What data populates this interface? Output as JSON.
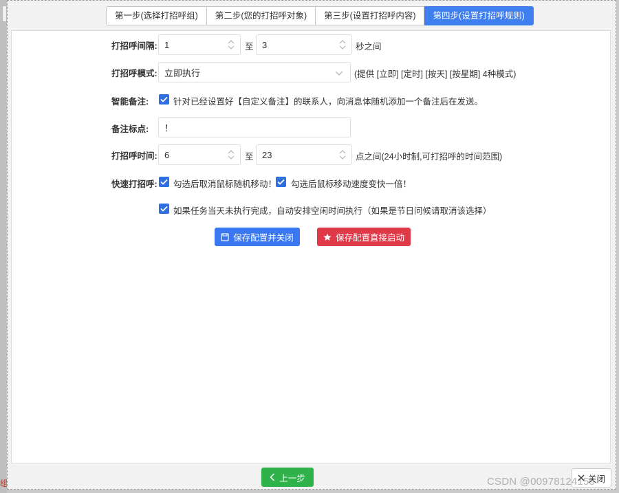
{
  "colors": {
    "accent": "#3f7ff0",
    "primary_button": "#3a78f2",
    "danger_button": "#e03a48",
    "success_button": "#2fb24a",
    "checkbox": "#2f6fe0"
  },
  "left_strip": {
    "text": "组"
  },
  "steps": [
    {
      "label": "第一步(选择打招呼组)",
      "active": false
    },
    {
      "label": "第二步(您的打招呼对象)",
      "active": false
    },
    {
      "label": "第三步(设置打招呼内容)",
      "active": false
    },
    {
      "label": "第四步(设置打招呼规则)",
      "active": true
    }
  ],
  "form": {
    "interval": {
      "label": "打招呼间隔:",
      "from": "1",
      "to_word": "至",
      "to": "3",
      "suffix": "秒之间"
    },
    "mode": {
      "label": "打招呼模式:",
      "selected": "立即执行",
      "hint": "(提供 [立即] [定时] [按天] [按星期] 4种模式)"
    },
    "smart_note": {
      "label": "智能备注:",
      "checked": true,
      "text": "针对已经设置好【自定义备注】的联系人，向消息体随机添加一个备注后在发送。"
    },
    "note_mark": {
      "label": "备注标点:",
      "value": "！"
    },
    "time_range": {
      "label": "打招呼时间:",
      "from": "6",
      "to_word": "至",
      "to": "23",
      "suffix": "点之间(24小时制,可打招呼的时间范围)"
    },
    "quick": {
      "label": "快速打招呼:",
      "option1": {
        "checked": true,
        "text": "勾选后取消鼠标随机移动！"
      },
      "option2": {
        "checked": true,
        "text": "勾选后鼠标移动速度变快一倍！"
      }
    },
    "auto_schedule": {
      "checked": true,
      "text": "如果任务当天未执行完成，自动安排空闲时间执行（如果是节日问候请取消该选择）"
    }
  },
  "buttons": {
    "save_close": "保存配置并关闭",
    "save_start": "保存配置直接启动",
    "prev": "上一步",
    "close": "关闭"
  },
  "watermark": "CSDN @00978124155"
}
